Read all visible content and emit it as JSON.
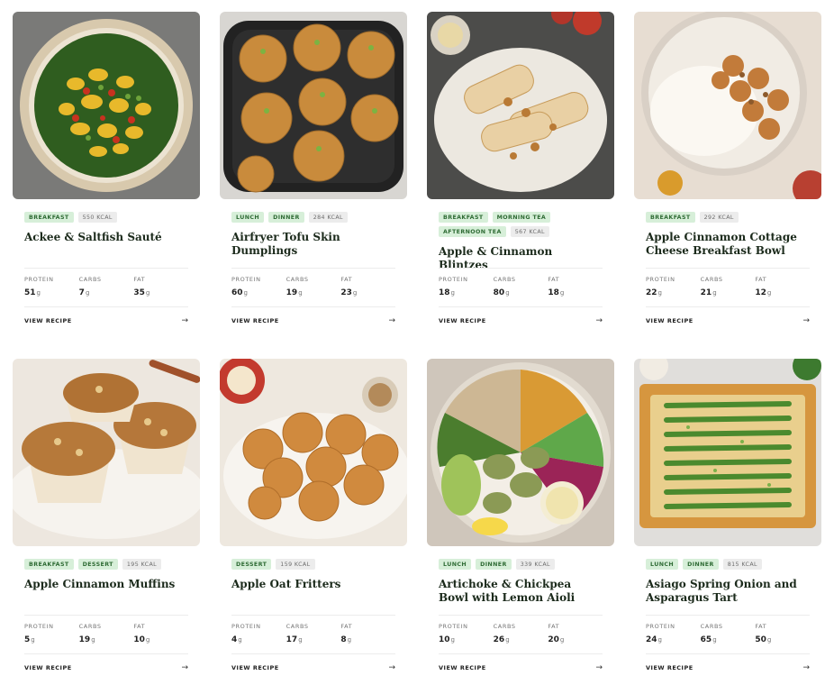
{
  "cards": [
    {
      "tags": [
        "Breakfast"
      ],
      "kcal": "550 KCAL",
      "title": "Ackee & Saltfish Sauté",
      "macros": {
        "protein": "51",
        "carbs": "7",
        "fat": "35"
      },
      "image": "ackee-saltfish-dish"
    },
    {
      "tags": [
        "Lunch",
        "Dinner"
      ],
      "kcal": "284 KCAL",
      "title": "Airfryer Tofu Skin Dumplings",
      "macros": {
        "protein": "60",
        "carbs": "19",
        "fat": "23"
      },
      "image": "tofu-skin-dumplings"
    },
    {
      "tags": [
        "Breakfast",
        "Morning Tea",
        "Afternoon Tea"
      ],
      "kcal": "567 KCAL",
      "title": "Apple & Cinnamon Blintzes",
      "macros": {
        "protein": "18",
        "carbs": "80",
        "fat": "18"
      },
      "image": "apple-blintzes"
    },
    {
      "tags": [
        "Breakfast"
      ],
      "kcal": "292 KCAL",
      "title": "Apple Cinnamon Cottage Cheese Breakfast Bowl",
      "macros": {
        "protein": "22",
        "carbs": "21",
        "fat": "12"
      },
      "image": "cottage-cheese-bowl"
    },
    {
      "tags": [
        "Breakfast",
        "Dessert"
      ],
      "kcal": "195 KCAL",
      "title": "Apple Cinnamon Muffins",
      "macros": {
        "protein": "5",
        "carbs": "19",
        "fat": "10"
      },
      "image": "apple-muffins"
    },
    {
      "tags": [
        "Dessert"
      ],
      "kcal": "159 KCAL",
      "title": "Apple Oat Fritters",
      "macros": {
        "protein": "4",
        "carbs": "17",
        "fat": "8"
      },
      "image": "apple-oat-fritters"
    },
    {
      "tags": [
        "Lunch",
        "Dinner"
      ],
      "kcal": "339 KCAL",
      "title": "Artichoke & Chickpea Bowl with Lemon Aioli",
      "macros": {
        "protein": "10",
        "carbs": "26",
        "fat": "20"
      },
      "image": "artichoke-bowl"
    },
    {
      "tags": [
        "Lunch",
        "Dinner"
      ],
      "kcal": "815 KCAL",
      "title": "Asiago Spring Onion and Asparagus Tart",
      "macros": {
        "protein": "24",
        "carbs": "65",
        "fat": "50"
      },
      "image": "asparagus-tart"
    }
  ],
  "labels": {
    "protein": "Protein",
    "carbs": "Carbs",
    "fat": "Fat",
    "unit": "g",
    "view_recipe": "View Recipe",
    "arrow": "→"
  },
  "colors": {
    "tag_bg": "#d7efd9",
    "tag_text": "#2e6b34",
    "kcal_bg": "#ececec",
    "kcal_text": "#6c6c6c"
  }
}
